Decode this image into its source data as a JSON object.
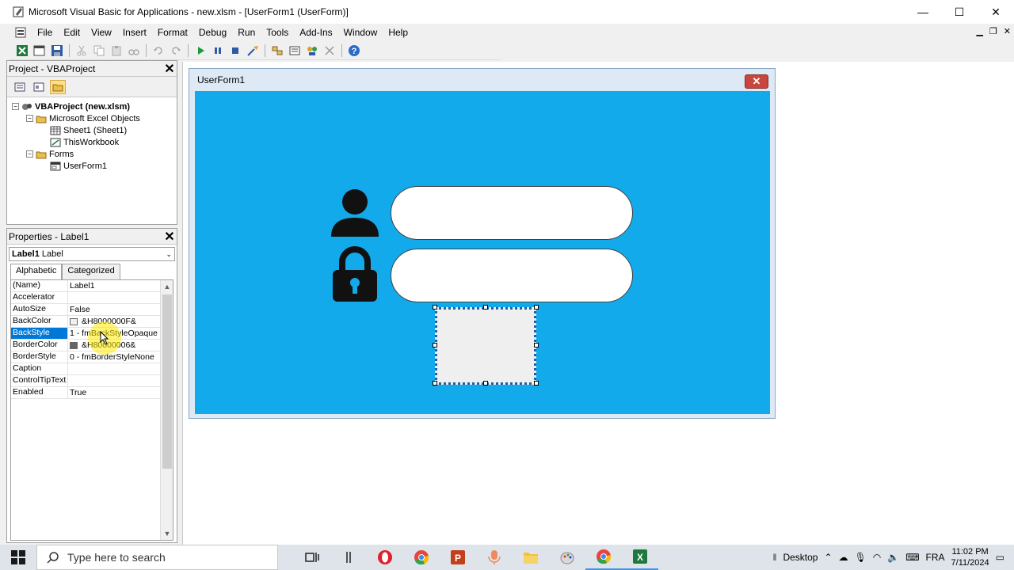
{
  "window": {
    "title": "Microsoft Visual Basic for Applications - new.xlsm - [UserForm1 (UserForm)]",
    "minimize": "—",
    "maximize": "☐",
    "close": "✕"
  },
  "menu": {
    "items": [
      "File",
      "Edit",
      "View",
      "Insert",
      "Format",
      "Debug",
      "Run",
      "Tools",
      "Add-Ins",
      "Window",
      "Help"
    ]
  },
  "project_panel": {
    "title": "Project - VBAProject",
    "tree": [
      {
        "label": "VBAProject (new.xlsm)",
        "level": 0
      },
      {
        "label": "Microsoft Excel Objects",
        "level": 1
      },
      {
        "label": "Sheet1 (Sheet1)",
        "level": 2
      },
      {
        "label": "ThisWorkbook",
        "level": 2
      },
      {
        "label": "Forms",
        "level": 1
      },
      {
        "label": "UserForm1",
        "level": 2
      }
    ]
  },
  "properties_panel": {
    "title": "Properties - Label1",
    "object_name": "Label1",
    "object_type": "Label",
    "tabs": [
      "Alphabetic",
      "Categorized"
    ],
    "rows": [
      {
        "name": "(Name)",
        "value": "Label1"
      },
      {
        "name": "Accelerator",
        "value": ""
      },
      {
        "name": "AutoSize",
        "value": "False"
      },
      {
        "name": "BackColor",
        "value": "&H8000000F&",
        "swatch": "#f0f0f0"
      },
      {
        "name": "BackStyle",
        "value": "1 - fmBackStyleOpaque"
      },
      {
        "name": "BorderColor",
        "value": "&H80000006&",
        "swatch": "#646464"
      },
      {
        "name": "BorderStyle",
        "value": "0 - fmBorderStyleNone"
      },
      {
        "name": "Caption",
        "value": ""
      },
      {
        "name": "ControlTipText",
        "value": ""
      },
      {
        "name": "Enabled",
        "value": "True"
      }
    ]
  },
  "userform": {
    "title": "UserForm1",
    "canvas_color": "#12aaea"
  },
  "taskbar": {
    "search_placeholder": "Type here to search",
    "desktop_label": "Desktop",
    "language": "FRA",
    "time": "11:02 PM",
    "date": "7/11/2024"
  }
}
